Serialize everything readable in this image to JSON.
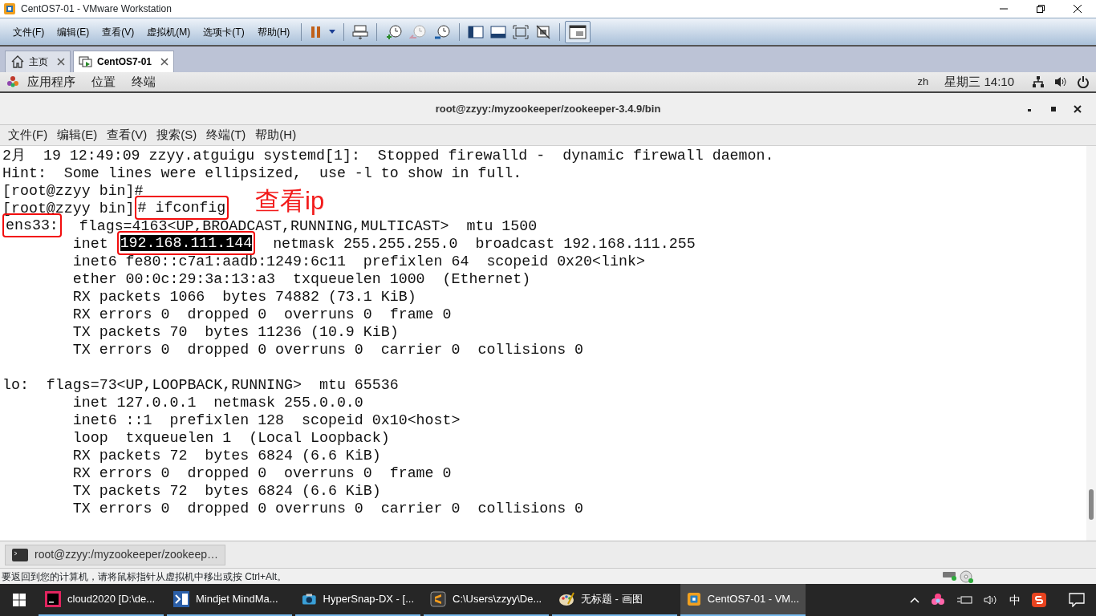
{
  "window": {
    "title": "CentOS7-01 - VMware Workstation"
  },
  "menu": [
    "文件(F)",
    "编辑(E)",
    "查看(V)",
    "虚拟机(M)",
    "选项卡(T)",
    "帮助(H)"
  ],
  "tabs": [
    {
      "label": "主页",
      "kind": "home",
      "selected": false
    },
    {
      "label": "CentOS7-01",
      "kind": "vm",
      "selected": true
    }
  ],
  "gnome_bar": {
    "menus": [
      "应用程序",
      "位置",
      "终端"
    ],
    "input_method": "zh",
    "clock": "星期三 14:10"
  },
  "terminal": {
    "title": "root@zzyy:/myzookeeper/zookeeper-3.4.9/bin",
    "menu": [
      "文件(F)",
      "编辑(E)",
      "查看(V)",
      "搜索(S)",
      "终端(T)",
      "帮助(H)"
    ],
    "blocks": [
      [
        "2月  19 12:49:09 zzyy.atguigu systemd[1]:  Stopped firewalld -  dynamic firewall daemon.",
        "Hint:  Some lines were ellipsized,  use -l to show in full.",
        "[root@zzyy bin]#",
        [
          {
            "text": "[root@zzyy bin]",
            "selected": false
          },
          {
            "text": "# ifconfig",
            "selected": false,
            "annotated": true
          }
        ],
        [
          {
            "text": "ens33:",
            "selected": false,
            "annotated": true
          },
          {
            "text": "  flags=4163<UP,BROADCAST,RUNNING,MULTICAST>  mtu 1500",
            "selected": false
          }
        ],
        [
          {
            "text": "        inet ",
            "selected": false
          },
          {
            "text": "192.168.111.144",
            "selected": true,
            "annotated": true
          },
          {
            "text": "  netmask 255.255.255.0  broadcast 192.168.111.255",
            "selected": false
          }
        ],
        "        inet6 fe80::c7a1:aadb:1249:6c11  prefixlen 64  scopeid 0x20<link>",
        "        ether 00:0c:29:3a:13:a3  txqueuelen 1000  (Ethernet)",
        "        RX packets 1066  bytes 74882 (73.1 KiB)",
        "        RX errors 0  dropped 0  overruns 0  frame 0",
        "        TX packets 70  bytes 11236 (10.9 KiB)",
        "        TX errors 0  dropped 0 overruns 0  carrier 0  collisions 0"
      ],
      [
        "lo:  flags=73<UP,LOOPBACK,RUNNING>  mtu 65536",
        "        inet 127.0.0.1  netmask 255.0.0.0",
        "        inet6 ::1  prefixlen 128  scopeid 0x10<host>",
        "        loop  txqueuelen 1  (Local Loopback)",
        "        RX packets 72  bytes 6824 (6.6 KiB)",
        "        RX errors 0  dropped 0  overruns 0  frame 0",
        "        TX packets 72  bytes 6824 (6.6 KiB)",
        "        TX errors 0  dropped 0 overruns 0  carrier 0  collisions 0"
      ]
    ],
    "annotation": "查看ip"
  },
  "window_list": [
    "root@zzyy:/myzookeeper/zookeep…"
  ],
  "status_bar": "要返回到您的计算机，请将鼠标指针从虚拟机中移出或按 Ctrl+Alt。",
  "taskbar": [
    {
      "label": "cloud2020 [D:\\de...",
      "kind": "ide",
      "selected": false
    },
    {
      "label": "Mindjet MindMa...",
      "kind": "mindmap",
      "selected": false
    },
    {
      "label": "HyperSnap-DX - [...",
      "kind": "camera",
      "selected": false
    },
    {
      "label": "C:\\Users\\zzyy\\De...",
      "kind": "sublime",
      "selected": false
    },
    {
      "label": "无标题 - 画图",
      "kind": "paint",
      "selected": false
    },
    {
      "label": "CentOS7-01 - VM...",
      "kind": "vmware",
      "selected": true
    }
  ],
  "tray": {
    "ime": "中"
  }
}
